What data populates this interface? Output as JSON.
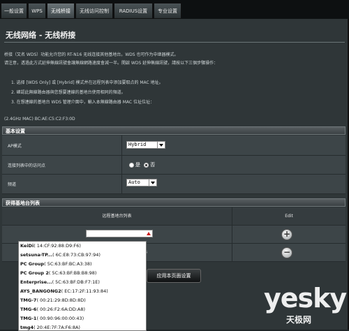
{
  "tabs": [
    {
      "label": "一般设置"
    },
    {
      "label": "WPS"
    },
    {
      "label": "无线桥接"
    },
    {
      "label": "无线访问控制"
    },
    {
      "label": "RADIUS设置"
    },
    {
      "label": "专业设置"
    }
  ],
  "page_title": "无线网络 - 无线桥接",
  "intro_line1": "桥接（又名 WDS）功能允许您的 RT-N16 无线连接其他基地台。WDS 也可作为中继器模式。",
  "intro_line2": "请注意，透過此方式延伸無線訊號會讓無線網路速度會減一半。開啟 WDS 延伸無線訊號，請按以下三個步驟操作：",
  "steps": [
    "1.   选择 [WDS Only] 或 [Hybrid] 模式并在远程列表中添加要取点的 MAC 地址。",
    "2.   確認此無線路由器與您想要連線的基地台使用相同的頻道。",
    "3.   在想連線的基地台 WDS 管理介面中，輸入本無線路由器 MAC 位址位址："
  ],
  "mac_line": "(2.4GHz MAC) BC:AE:C5:C2:F3:0D",
  "basic_section": {
    "header": "基本设置",
    "ap_mode_label": "AP模式",
    "ap_mode_value": "Hybrid",
    "connect_label": "连接列表中的访问点",
    "yes_label": "是",
    "no_label": "否",
    "channel_label": "频道",
    "channel_value": "Auto"
  },
  "remote_section": {
    "header": "获得基地台列表",
    "col_list": "远程基地台列表",
    "col_edit": "Edit",
    "row2_suffix": "04",
    "add_glyph": "+",
    "remove_glyph": "−"
  },
  "apply_label": "应用本页面设置",
  "dropdown_items": [
    {
      "name": "KeiDi",
      "mac": "( 14:CF:92:88:D9:F6)"
    },
    {
      "name": "setsuna-TP...",
      "mac": "( 6C:E8:73:CB:97:94)"
    },
    {
      "name": "PC Group",
      "mac": "( 5C:63:BF:BC:A3:38)"
    },
    {
      "name": "PC Group 2",
      "mac": "( 5C:63:BF:BB:B8:98)"
    },
    {
      "name": "Enterprise...",
      "mac": "( 5C:63:BF:DB:F7:1E)"
    },
    {
      "name": "AYS_BANGONG2",
      "mac": "( EC:17:2F:11:93:84)"
    },
    {
      "name": "TMG-7",
      "mac": "( 00:21:29:8D:8D:8D)"
    },
    {
      "name": "TMG-6",
      "mac": "( 00:26:F2:6A:DD:A8)"
    },
    {
      "name": "TMG-1",
      "mac": "( 00:90:96:00:00:43)"
    },
    {
      "name": "tmg4",
      "mac": "( 20:4E:7F:7A:F6:8A)"
    }
  ],
  "watermark": {
    "brand": "yesky",
    "cn": "天极网"
  },
  "colors": {
    "accent_red": "#cc1f1f",
    "section_bg": "#4a5053",
    "content_bg": "#2f3638"
  }
}
